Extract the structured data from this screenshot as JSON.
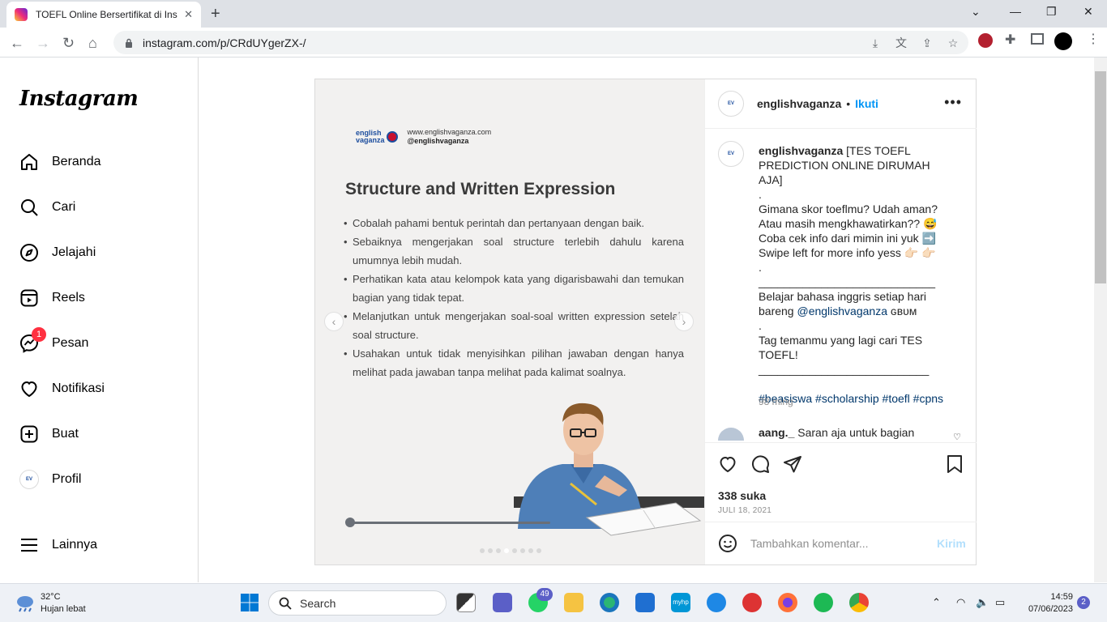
{
  "browser": {
    "tab_title": "TOEFL Online Bersertifikat di Insta",
    "url": "instagram.com/p/CRdUYgerZX-/"
  },
  "sidebar": {
    "logo": "Instagram",
    "items": [
      {
        "label": "Beranda",
        "icon": "home-icon"
      },
      {
        "label": "Cari",
        "icon": "search-icon"
      },
      {
        "label": "Jelajahi",
        "icon": "compass-icon"
      },
      {
        "label": "Reels",
        "icon": "reels-icon"
      },
      {
        "label": "Pesan",
        "icon": "messenger-icon",
        "badge": "1"
      },
      {
        "label": "Notifikasi",
        "icon": "heart-icon"
      },
      {
        "label": "Buat",
        "icon": "plus-square-icon"
      },
      {
        "label": "Profil",
        "icon": "profile-avatar"
      }
    ],
    "more_label": "Lainnya"
  },
  "slide": {
    "brand_top": "english",
    "brand_bottom": "vaganza",
    "website": "www.englishvaganza.com",
    "handle": "@englishvaganza",
    "title": "Structure and Written Expression",
    "bullets": [
      "Cobalah pahami bentuk perintah dan pertanyaan dengan baik.",
      "Sebaiknya mengerjakan soal structure terlebih dahulu karena umumnya lebih mudah.",
      "Perhatikan kata atau kelompok kata yang digarisbawahi dan temukan bagian yang tidak tepat.",
      "Melanjutkan untuk mengerjakan soal-soal written expression setelah soal structure.",
      "Usahakan untuk tidak menyisihkan pilihan jawaban dengan hanya melihat pada jawaban tanpa melihat pada kalimat soalnya."
    ],
    "prev": "‹",
    "next": "›"
  },
  "post": {
    "username": "englishvaganza",
    "dot": "•",
    "follow_label": "Ikuti",
    "more": "•••",
    "caption_user": "englishvaganza",
    "caption_lines": [
      " [TES TOEFL PREDICTION ONLINE DIRUMAH AJA]",
      ".",
      "Gimana skor toeflmu? Udah aman?",
      "Atau masih mengkhawatirkan?? 😅",
      "Coba cek info dari mimin ini yuk ➡️",
      "Swipe left for more info yess 👉🏻 👉🏻",
      ".",
      "____________________________",
      "Belajar bahasa inggris setiap hari bareng "
    ],
    "mention": "@englishvaganza",
    "mention_suffix": " ɢʙᴜᴍ",
    "caption_lines_2": [
      ".",
      "Tag temanmu yang lagi cari TES TOEFL!",
      "___________________________",
      ""
    ],
    "hashtags": "#beasiswa #scholarship #toefl #cpns",
    "caption_time": "98 ming",
    "comment_user": "aang._",
    "comment_text": " Saran aja untuk bagian",
    "likes": "338 suka",
    "date": "JULI 18, 2021",
    "comment_placeholder": "Tambahkan komentar...",
    "post_label": "Kirim"
  },
  "taskbar": {
    "temperature": "32°C",
    "weather": "Hujan lebat",
    "search_label": "Search",
    "whatsapp_badge": "49",
    "time": "14:59",
    "date": "07/06/2023",
    "notification_count": "2"
  }
}
